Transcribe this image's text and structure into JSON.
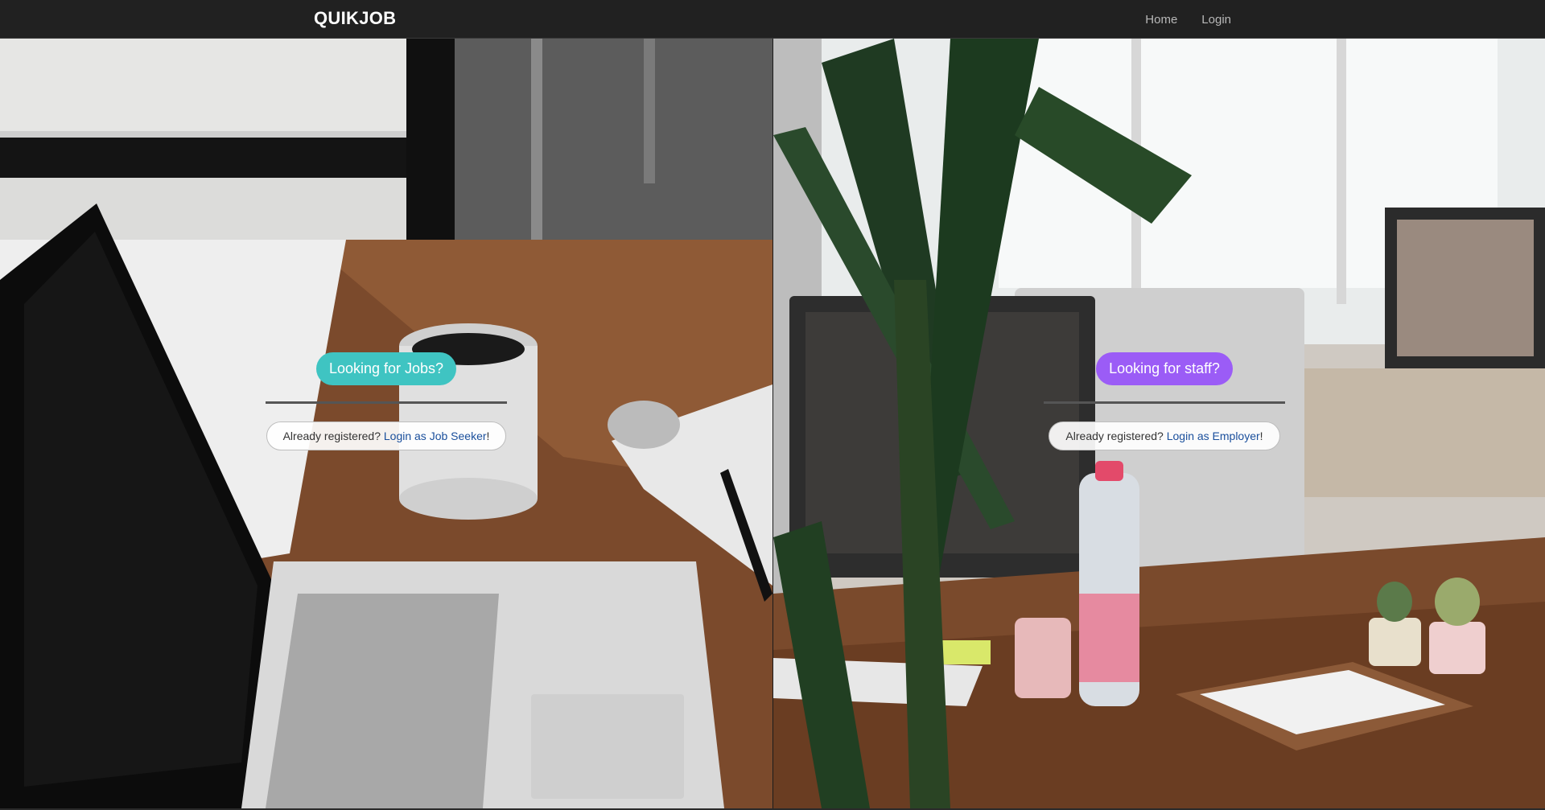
{
  "navbar": {
    "brand": "QUIKJOB",
    "links": [
      {
        "label": "Home"
      },
      {
        "label": "Login"
      }
    ]
  },
  "job_seeker": {
    "cta_label": "Looking for Jobs?",
    "prefix_text": "Already registered?",
    "link_text": "Login as Job Seeker",
    "suffix_text": "!",
    "accent_color": "#3fc4c2"
  },
  "employer": {
    "cta_label": "Looking for staff?",
    "prefix_text": "Already registered?",
    "link_text": "Login as Employer",
    "suffix_text": "!",
    "accent_color": "#9b5cf6"
  },
  "backgrounds": {
    "left": "desk-with-laptop-and-coffee-mug-photo",
    "right": "office-desk-with-computers-and-plant-photo"
  }
}
